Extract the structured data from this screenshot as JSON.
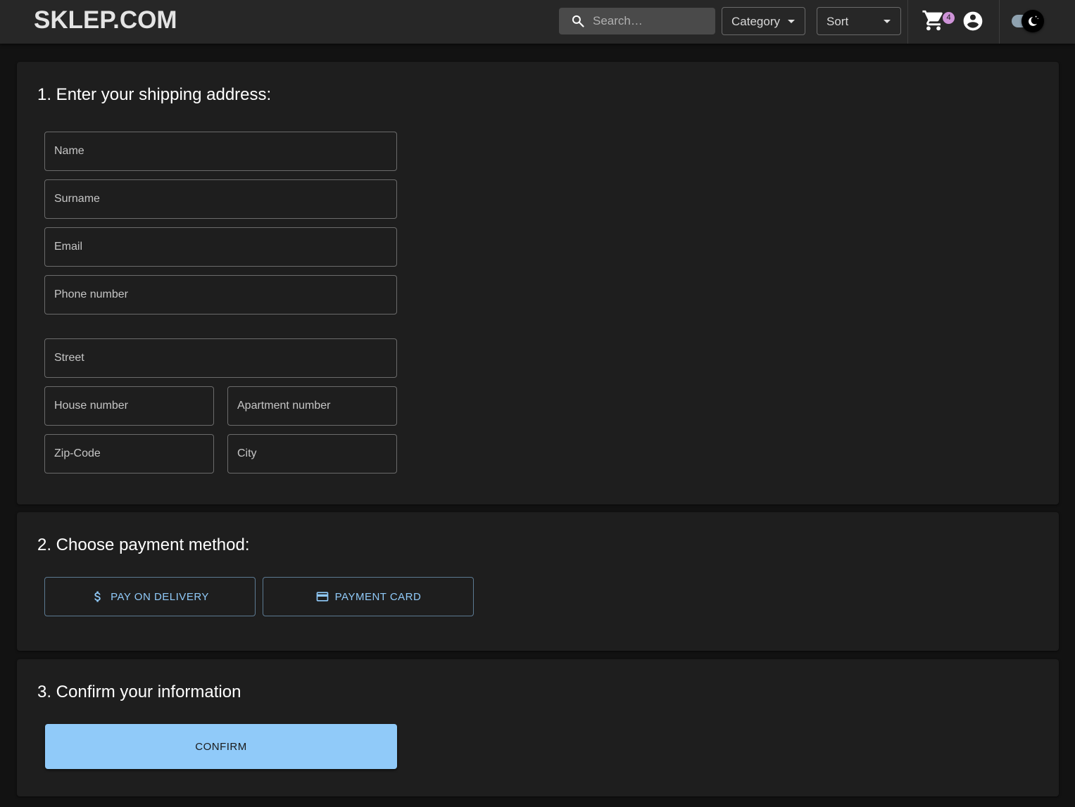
{
  "header": {
    "logo": "SKLEP.COM",
    "search_placeholder": "Search…",
    "category_label": "Category",
    "sort_label": "Sort",
    "cart_count": "4"
  },
  "shipping": {
    "title": "1. Enter your shipping address:",
    "fields": {
      "name": "Name",
      "surname": "Surname",
      "email": "Email",
      "phone": "Phone number",
      "street": "Street",
      "house": "House number",
      "apartment": "Apartment number",
      "zip": "Zip-Code",
      "city": "City"
    }
  },
  "payment": {
    "title": "2. Choose payment method:",
    "delivery_label": "PAY ON DELIVERY",
    "card_label": "PAYMENT CARD"
  },
  "confirm": {
    "title": "3. Confirm your information",
    "button_label": "CONFIRM"
  },
  "colors": {
    "accent": "#90caf9",
    "badge": "#ce93d8",
    "card_bg": "#1e1e1e",
    "page_bg": "#121212"
  }
}
